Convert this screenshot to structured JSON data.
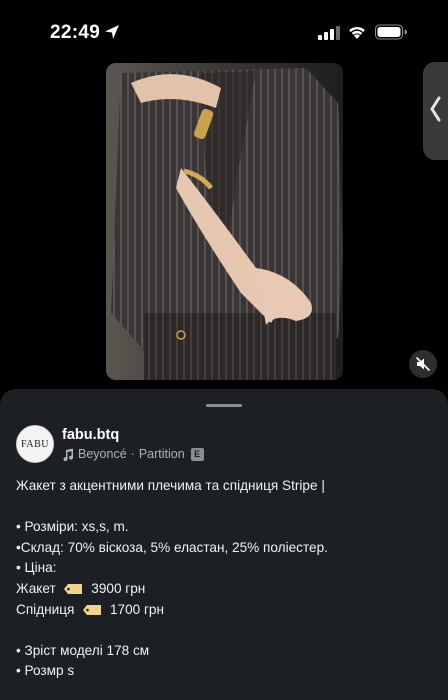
{
  "status_bar": {
    "time": "22:49",
    "icons": [
      "location-arrow-icon",
      "signal-icon",
      "wifi-icon",
      "battery-icon"
    ]
  },
  "video": {
    "muted": true
  },
  "post": {
    "avatar_text": "FABU",
    "username": "fabu.btq",
    "music": {
      "artist": "Beyoncé",
      "separator": "·",
      "track": "Partition",
      "explicit_badge": "E"
    },
    "caption": {
      "title": "Жакет з акцентними плечима та спідниця Stripe |",
      "sizes": "• Розміри: xs,s, m.",
      "composition": "•Склад: 70% віскоза, 5% еластан, 25% поліестер.",
      "price_heading": "• Ціна:",
      "jacket_label": "Жакет",
      "jacket_price": "3900 грн",
      "skirt_label": "Спідниця",
      "skirt_price": "1700 грн",
      "model_height": "• Зріст моделі 178 см",
      "model_size": "• Розмр s"
    }
  },
  "colors": {
    "background": "#000000",
    "sheet": "#1c1f24",
    "secondary_text": "#b0b3b8",
    "tag_emoji": "#f3d28a"
  }
}
